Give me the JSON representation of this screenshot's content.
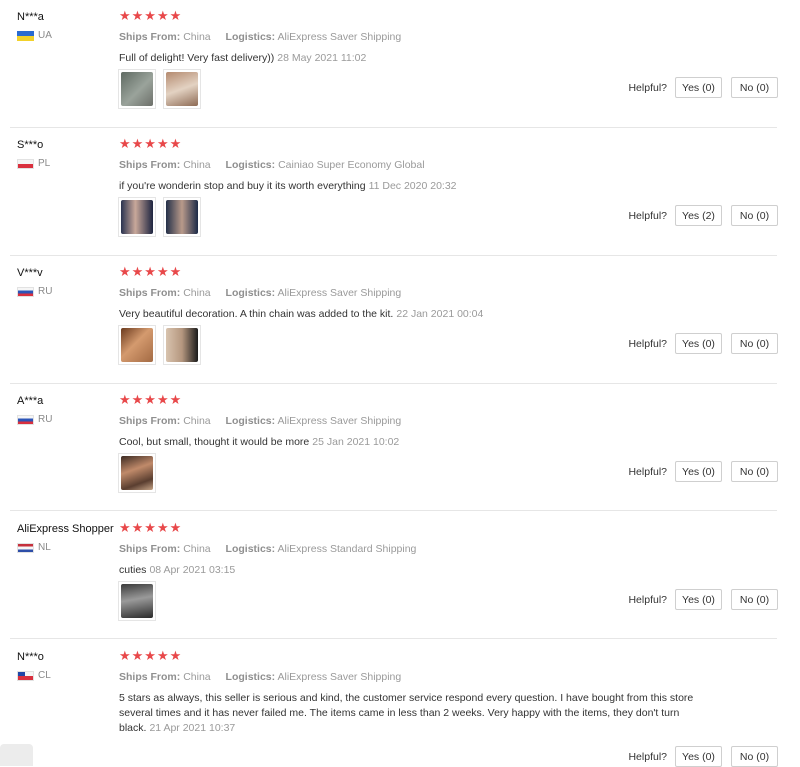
{
  "labels": {
    "ships_from": "Ships From:",
    "logistics": "Logistics:",
    "helpful": "Helpful?"
  },
  "reviews": [
    {
      "user": "N***a",
      "country": "UA",
      "stars": "★★★★★",
      "ships_from": "China",
      "logistics": "AliExpress Saver Shipping",
      "text": "Full of delight! Very fast delivery))",
      "date": "28 May 2021 11:02",
      "yes": "Yes (0)",
      "no": "No (0)"
    },
    {
      "user": "S***o",
      "country": "PL",
      "stars": "★★★★★",
      "ships_from": "China",
      "logistics": "Cainiao Super Economy Global",
      "text": "if you're wonderin stop and buy it its worth everything",
      "date": "11 Dec 2020 20:32",
      "yes": "Yes (2)",
      "no": "No (0)"
    },
    {
      "user": "V***v",
      "country": "RU",
      "stars": "★★★★★",
      "ships_from": "China",
      "logistics": "AliExpress Saver Shipping",
      "text": "Very beautiful decoration. A thin chain was added to the kit.",
      "date": "22 Jan 2021 00:04",
      "yes": "Yes (0)",
      "no": "No (0)"
    },
    {
      "user": "A***a",
      "country": "RU",
      "stars": "★★★★★",
      "ships_from": "China",
      "logistics": "AliExpress Saver Shipping",
      "text": "Cool, but small, thought it would be more",
      "date": "25 Jan 2021 10:02",
      "yes": "Yes (0)",
      "no": "No (0)"
    },
    {
      "user": "AliExpress Shopper",
      "country": "NL",
      "stars": "★★★★★",
      "ships_from": "China",
      "logistics": "AliExpress Standard Shipping",
      "text": "cuties",
      "date": "08 Apr 2021 03:15",
      "yes": "Yes (0)",
      "no": "No (0)"
    },
    {
      "user": "N***o",
      "country": "CL",
      "stars": "★★★★★",
      "ships_from": "China",
      "logistics": "AliExpress Saver Shipping",
      "text": "5 stars as always, this seller is serious and kind, the customer service respond every question. I have bought from this store several times and it has never failed me. The items came in less than 2 weeks. Very happy with the items, they don't turn black.",
      "date": "21 Apr 2021 10:37",
      "yes": "Yes (0)",
      "no": "No (0)"
    }
  ]
}
